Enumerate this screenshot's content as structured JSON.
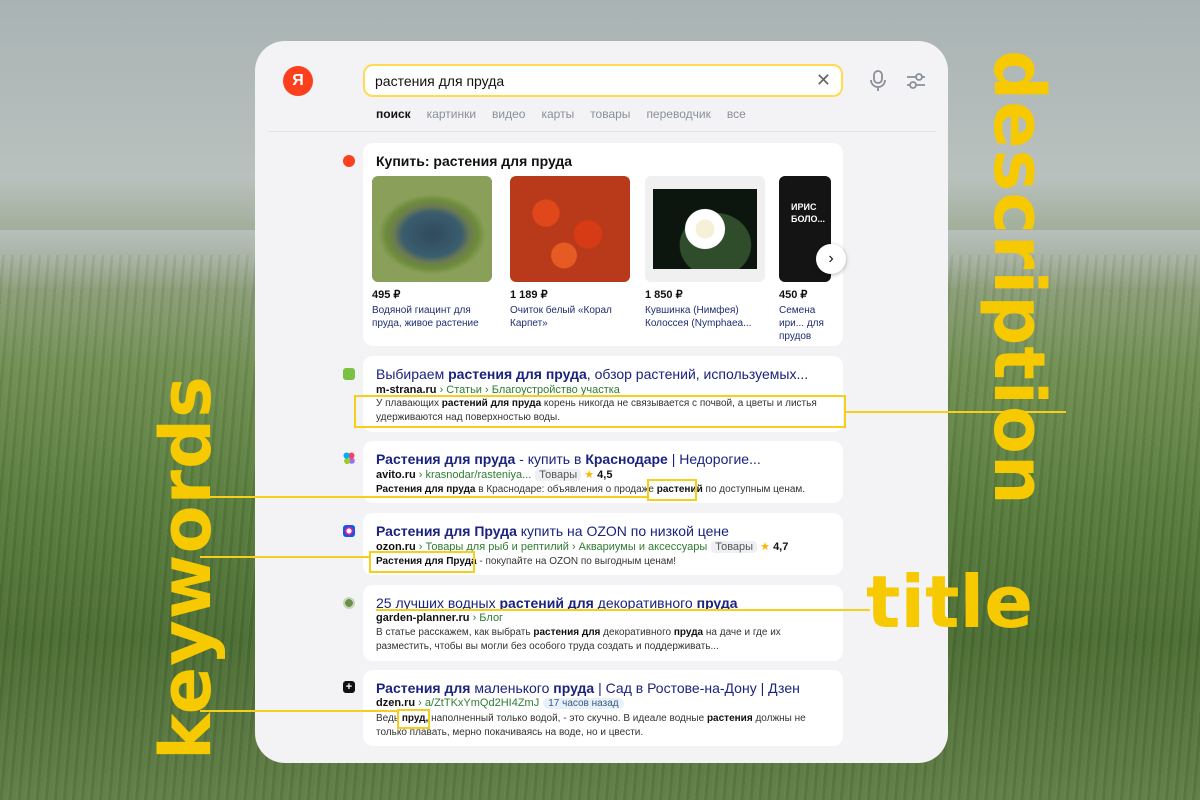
{
  "search": {
    "query": "растения для пруда",
    "logo": "Я"
  },
  "tabs": [
    "поиск",
    "картинки",
    "видео",
    "карты",
    "товары",
    "переводчик",
    "все"
  ],
  "products": {
    "title": "Купить: растения для пруда",
    "items": [
      {
        "price": "495 ₽",
        "name": "Водяной гиацинт для пруда, живое растение",
        "image": "pond-image"
      },
      {
        "price": "1 189 ₽",
        "name": "Очиток белый «Корал Карпет»",
        "image": "red-flowers-image"
      },
      {
        "price": "1 850 ₽",
        "name": "Кувшинка (Нимфея) Колоссея (Nymphaea...",
        "image": "water-lily-image"
      },
      {
        "price": "450 ₽",
        "name": "Семена ири... для прудов",
        "banner": "ИРИС БОЛО...",
        "image": "iris-banner-image"
      }
    ]
  },
  "results": [
    {
      "title_pre": "Выбираем ",
      "title_b": "растения для пруда",
      "title_post": ", обзор растений, используемых...",
      "domain": "m-strana.ru",
      "path": " › Статьи › Благоустройство участка",
      "desc_pre": "У плавающих ",
      "desc_b": "растений для пруда",
      "desc_post": " корень никогда не связывается с почвой, а цветы и листья удерживаются над поверхностью воды."
    },
    {
      "title_b": "Растения для пруда",
      "title_post": " - купить в ",
      "title_b2": "Краснодаре",
      "title_end": " | Недорогие...",
      "domain": "avito.ru",
      "path": " › krasnodar/rasteniya...",
      "badge": "Товары",
      "rating": "4,5",
      "desc_b": "Растения для пруда",
      "desc_mid": " в Краснодаре: объявления о продаже ",
      "desc_b2": "растений",
      "desc_post": " по доступным ценам."
    },
    {
      "title_b": "Растения для Пруда",
      "title_post": " купить на OZON по низкой цене",
      "domain": "ozon.ru",
      "path": " › Товары для рыб и рептилий › Аквариумы и аксессуары",
      "badge": "Товары",
      "rating": "4,7",
      "desc_b": "Растения для Пруда",
      "desc_post": " - покупайте на OZON по выгодным ценам!"
    },
    {
      "title_pre": "25 лучших водных ",
      "title_b": "растений для",
      "title_mid": " декоративного ",
      "title_b2": "пруда",
      "domain": "garden-planner.ru",
      "path": " › Блог",
      "desc_pre": "В статье расскажем, как выбрать ",
      "desc_b": "растения для",
      "desc_mid": " декоративного ",
      "desc_b2": "пруда",
      "desc_post": " на даче и где их разместить, чтобы вы могли без особого труда создать и поддерживать..."
    },
    {
      "title_b": "Растения для",
      "title_mid": " маленького ",
      "title_b2": "пруда",
      "title_post": " | Сад в Ростове-на-Дону | Дзен",
      "domain": "dzen.ru",
      "path": " › a/ZtTKxYmQd2HI4ZmJ",
      "time": "17 часов назад",
      "desc_pre": "Ведь ",
      "desc_b": "пруд,",
      "desc_mid": " наполненный только водой, - это скучно. В идеале водные ",
      "desc_b2": "растения",
      "desc_post": " должны не только плавать, мерно покачиваясь на воде, но и цвести."
    }
  ],
  "labels": {
    "keywords": "keywords",
    "description": "description",
    "title": "title"
  },
  "colors": {
    "accent": "#f5cf1c",
    "search_border": "#ffdb4d",
    "logo": "#fc3f1d",
    "link": "#1a237e",
    "url": "#2e7d32"
  }
}
